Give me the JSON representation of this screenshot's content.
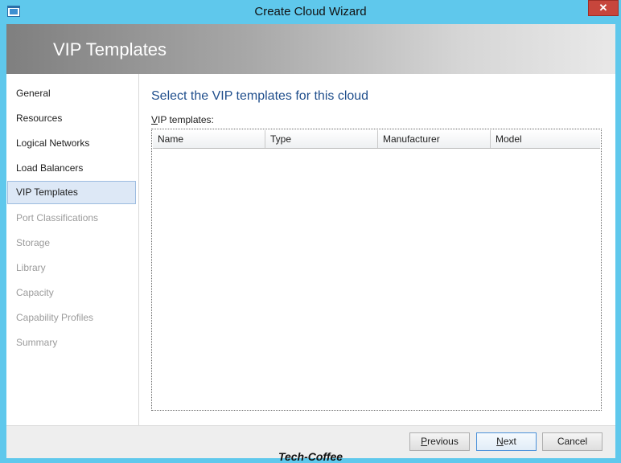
{
  "window": {
    "title": "Create Cloud Wizard",
    "close_label": "✕"
  },
  "banner": {
    "title": "VIP Templates"
  },
  "sidebar": {
    "items": [
      {
        "label": "General",
        "state": "enabled"
      },
      {
        "label": "Resources",
        "state": "enabled"
      },
      {
        "label": "Logical Networks",
        "state": "enabled"
      },
      {
        "label": "Load Balancers",
        "state": "enabled"
      },
      {
        "label": "VIP Templates",
        "state": "selected"
      },
      {
        "label": "Port Classifications",
        "state": "disabled"
      },
      {
        "label": "Storage",
        "state": "disabled"
      },
      {
        "label": "Library",
        "state": "disabled"
      },
      {
        "label": "Capacity",
        "state": "disabled"
      },
      {
        "label": "Capability Profiles",
        "state": "disabled"
      },
      {
        "label": "Summary",
        "state": "disabled"
      }
    ]
  },
  "main": {
    "heading": "Select the VIP templates for this cloud",
    "list_label_accel": "V",
    "list_label_rest": "IP templates:",
    "columns": [
      "Name",
      "Type",
      "Manufacturer",
      "Model"
    ]
  },
  "footer": {
    "previous_accel": "P",
    "previous_rest": "revious",
    "next_accel": "N",
    "next_rest": "ext",
    "cancel_label": "Cancel"
  },
  "watermark": "Tech-Coffee",
  "colors": {
    "frame": "#5fc8ec",
    "heading": "#1f4e8c",
    "selected_bg": "#dde8f6",
    "close": "#c7463c"
  }
}
